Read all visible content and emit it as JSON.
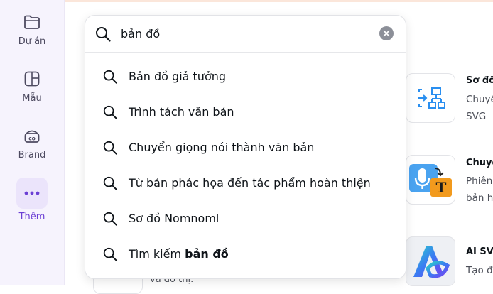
{
  "sidebar": {
    "items": [
      {
        "label": "Dự án",
        "icon": "folder-icon"
      },
      {
        "label": "Mẫu",
        "icon": "template-icon"
      },
      {
        "label": "Brand",
        "icon": "brand-icon"
      },
      {
        "label": "Thêm",
        "icon": "more-dots-icon"
      }
    ]
  },
  "search": {
    "value": "bản đồ",
    "suggestions": [
      "Bản đồ giả tưởng",
      "Trình tách văn bản",
      "Chuyển giọng nói thành văn bản",
      "Từ bản phác họa đến tác phẩm hoàn thiện",
      "Sơ đồ Nomnoml"
    ],
    "last_suggestion_prefix": "Tìm kiếm ",
    "last_suggestion_query": "bản đồ"
  },
  "cards": [
    {
      "title": "Sơ đồ",
      "desc1": "Chuyể",
      "desc2": "SVG",
      "icon": "diagram-svg-icon"
    },
    {
      "title": "Chuyể",
      "desc1": "Phiên",
      "desc2": "bản h",
      "icon": "speech-to-text-icon"
    },
    {
      "title": "AI SVG",
      "desc1": "Tạo đ",
      "desc2": "",
      "icon": "ai-svg-logo-icon"
    }
  ],
  "underlying_text": "và đồ thị.",
  "colors": {
    "accent": "#6b3fd4",
    "sidebar_bg": "#f6f3fd",
    "more_bg": "#ebe4fb"
  }
}
